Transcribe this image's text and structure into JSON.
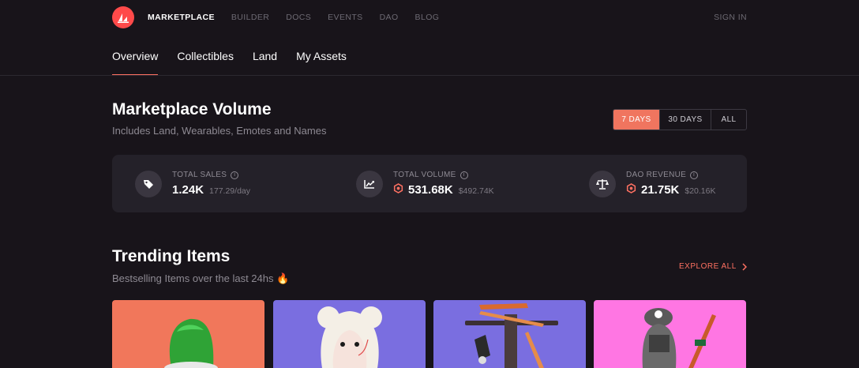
{
  "nav": {
    "items": [
      {
        "label": "MARKETPLACE",
        "active": true
      },
      {
        "label": "BUILDER"
      },
      {
        "label": "DOCS"
      },
      {
        "label": "EVENTS"
      },
      {
        "label": "DAO"
      },
      {
        "label": "BLOG"
      }
    ],
    "sign_in": "SIGN IN"
  },
  "subnav": {
    "tabs": [
      {
        "label": "Overview",
        "active": true
      },
      {
        "label": "Collectibles"
      },
      {
        "label": "Land"
      },
      {
        "label": "My Assets"
      }
    ]
  },
  "volume": {
    "title": "Marketplace Volume",
    "subtitle": "Includes Land, Wearables, Emotes and Names",
    "ranges": [
      {
        "label": "7 DAYS",
        "active": true
      },
      {
        "label": "30 DAYS"
      },
      {
        "label": "ALL"
      }
    ],
    "stats": [
      {
        "label": "TOTAL SALES",
        "value": "1.24K",
        "extra": "177.29/day",
        "icon": "tag-icon"
      },
      {
        "label": "TOTAL VOLUME",
        "value": "531.68K",
        "extra": "$492.74K",
        "icon": "trend-chart-icon"
      },
      {
        "label": "DAO REVENUE",
        "value": "21.75K",
        "extra": "$20.16K",
        "icon": "scale-icon"
      }
    ]
  },
  "trending": {
    "title": "Trending Items",
    "subtitle": "Bestselling Items over the last 24hs 🔥",
    "explore_label": "EXPLORE ALL",
    "cards": [
      {
        "name": "green-hat",
        "bg": "#f1775b"
      },
      {
        "name": "white-hair-avatar",
        "bg": "#7a6ee0"
      },
      {
        "name": "weapons-rack",
        "bg": "#7a6ee0"
      },
      {
        "name": "soldier-avatar",
        "bg": "#ff76e3"
      }
    ]
  },
  "colors": {
    "accent": "#ff7162",
    "brand_logo": "#ff4a4a",
    "background": "#18141a",
    "panel": "#242129"
  }
}
